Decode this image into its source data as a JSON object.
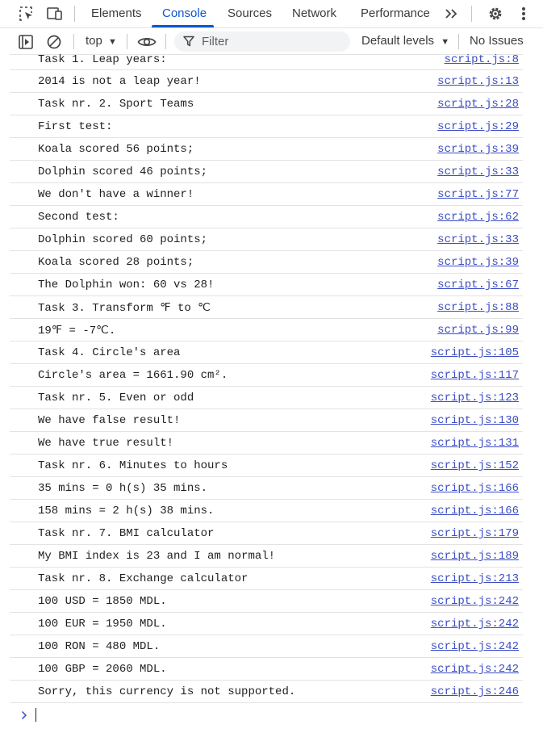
{
  "tabs": [
    {
      "label": "Elements"
    },
    {
      "label": "Console"
    },
    {
      "label": "Sources"
    },
    {
      "label": "Network"
    },
    {
      "label": "Performance"
    }
  ],
  "colors": {
    "accent": "#0b57d0",
    "link": "#3c4dc4"
  },
  "toolbar": {
    "context": "top",
    "filter_placeholder": "Filter",
    "levels": "Default levels",
    "issues": "No Issues"
  },
  "console": {
    "messages": [
      {
        "text": "Task 1. Leap years:",
        "source": "script.js:8"
      },
      {
        "text": "2014 is not a leap year!",
        "source": "script.js:13"
      },
      {
        "text": "Task nr. 2. Sport Teams",
        "source": "script.js:28"
      },
      {
        "text": "First test:",
        "source": "script.js:29"
      },
      {
        "text": "Koala scored 56 points;",
        "source": "script.js:39"
      },
      {
        "text": "Dolphin scored 46 points;",
        "source": "script.js:33"
      },
      {
        "text": "We don't have a winner!",
        "source": "script.js:77"
      },
      {
        "text": "Second test:",
        "source": "script.js:62"
      },
      {
        "text": "Dolphin scored 60 points;",
        "source": "script.js:33"
      },
      {
        "text": "Koala scored 28 points;",
        "source": "script.js:39"
      },
      {
        "text": "The Dolphin won: 60 vs 28!",
        "source": "script.js:67"
      },
      {
        "text": "Task 3. Transform ℉ to ℃",
        "source": "script.js:88"
      },
      {
        "text": "19℉ = -7℃.",
        "source": "script.js:99"
      },
      {
        "text": "Task 4. Circle's area",
        "source": "script.js:105"
      },
      {
        "text": "Circle's area = 1661.90 cm².",
        "source": "script.js:117"
      },
      {
        "text": "Task nr. 5. Even or odd",
        "source": "script.js:123"
      },
      {
        "text": "We have false result!",
        "source": "script.js:130"
      },
      {
        "text": "We have true result!",
        "source": "script.js:131"
      },
      {
        "text": "Task nr. 6. Minutes to hours",
        "source": "script.js:152"
      },
      {
        "text": "35 mins = 0 h(s) 35 mins.",
        "source": "script.js:166"
      },
      {
        "text": "158 mins = 2 h(s) 38 mins.",
        "source": "script.js:166"
      },
      {
        "text": "Task nr. 7. BMI calculator",
        "source": "script.js:179"
      },
      {
        "text": "My BMI index is 23 and I am normal!",
        "source": "script.js:189"
      },
      {
        "text": "Task nr. 8. Exchange calculator",
        "source": "script.js:213"
      },
      {
        "text": "100 USD = 1850 MDL.",
        "source": "script.js:242"
      },
      {
        "text": "100 EUR = 1950 MDL.",
        "source": "script.js:242"
      },
      {
        "text": "100 RON = 480 MDL.",
        "source": "script.js:242"
      },
      {
        "text": "100 GBP = 2060 MDL.",
        "source": "script.js:242"
      },
      {
        "text": "Sorry, this currency is not supported.",
        "source": "script.js:246"
      }
    ]
  }
}
